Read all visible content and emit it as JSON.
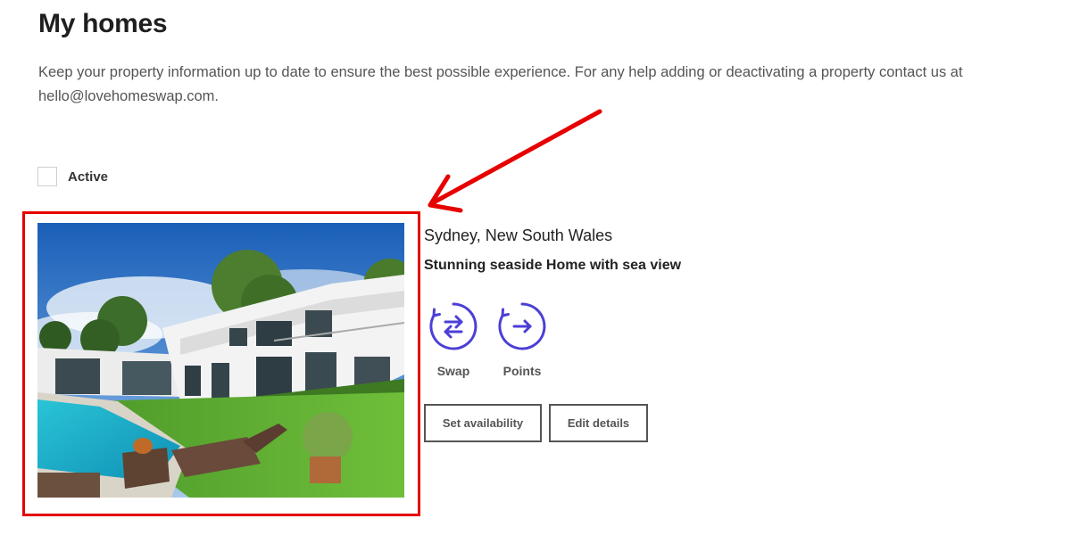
{
  "page": {
    "title": "My homes",
    "intro": "Keep your property information up to date to ensure the best possible experience. For any help adding or deactivating a property contact us at hello@lovehomeswap.com."
  },
  "filter": {
    "active_label": "Active",
    "active_checked": false
  },
  "home": {
    "location": "Sydney, New South Wales",
    "title": "Stunning seaside Home with sea view",
    "photo_icon": "villa-photo",
    "options": [
      {
        "label": "Swap",
        "icon": "swap-arrows-icon"
      },
      {
        "label": "Points",
        "icon": "arrow-right-icon"
      }
    ],
    "buttons": {
      "set_availability": "Set availability",
      "edit_details": "Edit details"
    }
  },
  "colors": {
    "accent": "#4b3fd6",
    "annotation": "#e60000",
    "button_border": "#555555"
  }
}
